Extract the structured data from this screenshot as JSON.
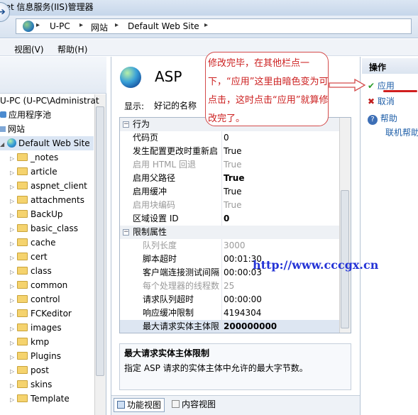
{
  "window": {
    "title": "net 信息服务(IIS)管理器"
  },
  "breadcrumb": [
    "U-PC",
    "网站",
    "Default Web Site"
  ],
  "menu": [
    "视图(V)",
    "帮助(H)"
  ],
  "tree": {
    "items": [
      "U-PC (U-PC\\Administrat",
      "应用程序池",
      "网站",
      "Default Web Site",
      "_notes",
      "article",
      "aspnet_client",
      "attachments",
      "BackUp",
      "basic_class",
      "cache",
      "cert",
      "class",
      "common",
      "control",
      "FCKeditor",
      "images",
      "kmp",
      "Plugins",
      "post",
      "skins",
      "Template"
    ]
  },
  "feature": {
    "title": "ASP",
    "show_label": "显示:",
    "show_value": "好记的名称"
  },
  "grid": {
    "rows": [
      {
        "type": "section",
        "key": "行为",
        "value": ""
      },
      {
        "type": "item",
        "key": "代码页",
        "value": "0"
      },
      {
        "type": "item",
        "key": "发生配置更改时重新启",
        "value": "True"
      },
      {
        "type": "disabled",
        "key": "启用 HTML 回退",
        "value": "True"
      },
      {
        "type": "item",
        "key": "启用父路径",
        "value": "True",
        "bold": true
      },
      {
        "type": "item",
        "key": "启用缓冲",
        "value": "True"
      },
      {
        "type": "disabled",
        "key": "启用块编码",
        "value": "True"
      },
      {
        "type": "item",
        "key": "区域设置 ID",
        "value": "0",
        "bold": true
      },
      {
        "type": "section",
        "key": "限制属性",
        "value": ""
      },
      {
        "type": "subdisabled",
        "key": "队列长度",
        "value": "3000"
      },
      {
        "type": "sub",
        "key": "脚本超时",
        "value": "00:01:30"
      },
      {
        "type": "sub",
        "key": "客户端连接测试间隔",
        "value": "00:00:03"
      },
      {
        "type": "subdisabled",
        "key": "每个处理器的线程数",
        "value": "25"
      },
      {
        "type": "sub",
        "key": "请求队列超时",
        "value": "00:00:00"
      },
      {
        "type": "sub",
        "key": "响应缓冲限制",
        "value": "4194304"
      },
      {
        "type": "subselected",
        "key": "最大请求实体主体限",
        "value": "200000000",
        "bold": true
      }
    ]
  },
  "description": {
    "title": "最大请求实体主体限制",
    "text": "指定 ASP 请求的实体主体中允许的最大字节数。"
  },
  "tabs": [
    "功能视图",
    "内容视图"
  ],
  "actions": {
    "header": "操作",
    "apply": "应用",
    "cancel": "取消",
    "help": "帮助",
    "online_help": "联机帮助"
  },
  "annotation": {
    "text": "修改完毕，在其他栏点一下，“应用”这里由暗色变为可点击，这时点击“应用”就算修改完了。"
  },
  "watermark": "http://www.cccgx.cn",
  "colors": {
    "annotation": "#cc2020",
    "link": "#1f5fa8",
    "watermark": "#2433d6"
  }
}
